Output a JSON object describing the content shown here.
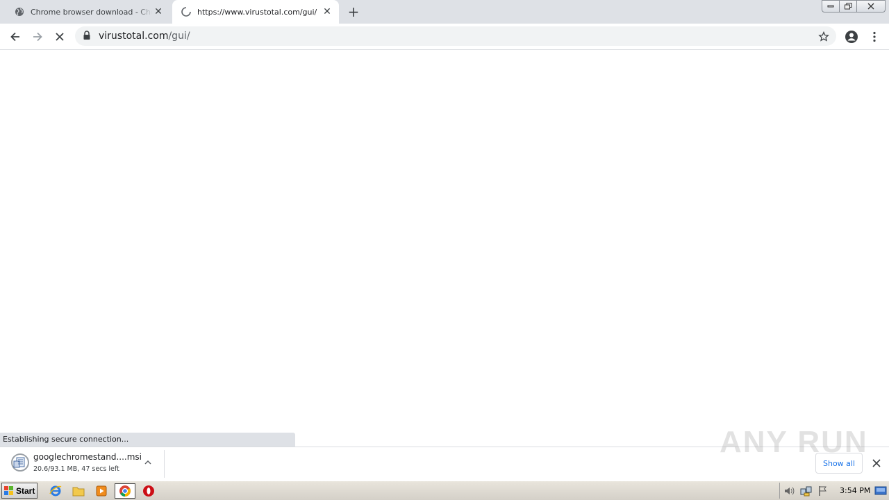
{
  "tabs": [
    {
      "title": "Chrome browser download - Chrome Enterprise",
      "icon": "globe-icon",
      "active": false
    },
    {
      "title": "https://www.virustotal.com/gui/",
      "icon": "loading-spinner-icon",
      "active": true
    }
  ],
  "toolbar": {
    "url_host": "virustotal.com",
    "url_path": "/gui/"
  },
  "status_bar": {
    "text": "Establishing secure connection..."
  },
  "download": {
    "filename": "googlechromestand....msi",
    "progress": "20.6/93.1 MB, 47 secs left",
    "show_all_label": "Show all"
  },
  "watermark": {
    "text": "ANY RUN"
  },
  "taskbar": {
    "start_label": "Start",
    "clock": "3:54 PM"
  },
  "colors": {
    "accent": "#1a73e8",
    "tabstrip": "#dee1e6"
  }
}
